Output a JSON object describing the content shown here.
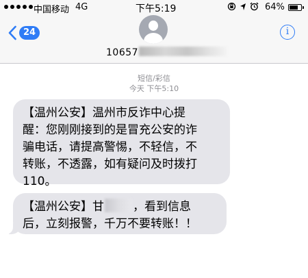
{
  "status_bar": {
    "carrier": "中国移动",
    "network": "4G",
    "time": "下午5:19",
    "battery": "64%",
    "battery_level": 0.64
  },
  "nav": {
    "back_count": "24",
    "contact_number": "10657",
    "info_icon": "info-icon"
  },
  "conversation": {
    "message_type": "短信/彩信",
    "timestamp": "今天 下午5:10",
    "messages": [
      {
        "lines": [
          "【温州公安】温州市反诈中心提",
          "醒：您刚刚接到的是冒充公安的诈",
          "骗电话，请提高警惕，不轻信，不",
          "转账，不透露，如有疑问及时拨打",
          "110。"
        ]
      },
      {
        "line1_before": "【温州公安】甘",
        "line1_after": "，看到信息",
        "line2": "后，立刻报警，千万不要转账！！"
      }
    ]
  },
  "colors": {
    "accent": "#2f7cf6",
    "bubble": "#e5e5ea",
    "header_bg": "#f7f7f7",
    "meta_text": "#8e8e93"
  }
}
